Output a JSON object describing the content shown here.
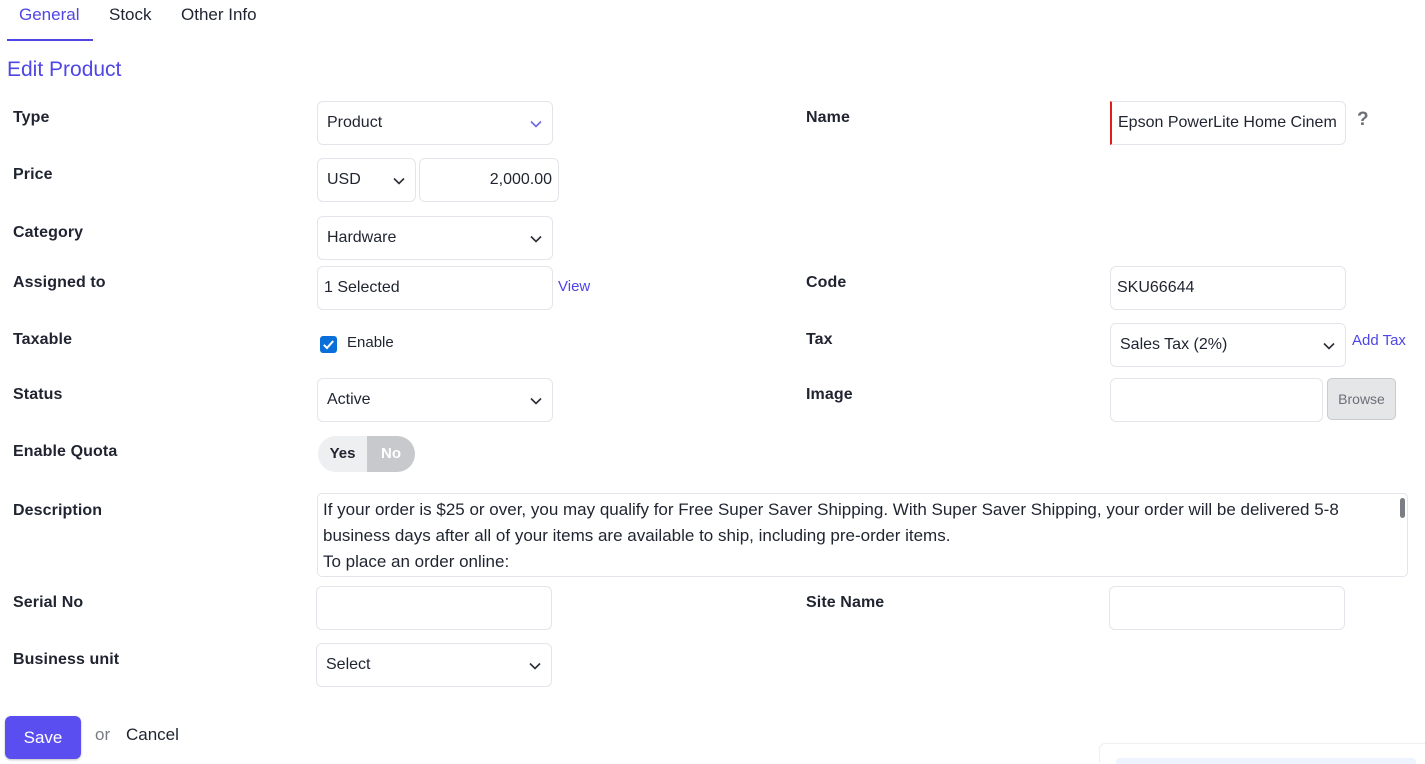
{
  "tabs": [
    {
      "label": "General",
      "active": true
    },
    {
      "label": "Stock",
      "active": false
    },
    {
      "label": "Other Info",
      "active": false
    }
  ],
  "page_title": "Edit Product",
  "accent_color": "#4f46e5",
  "form": {
    "type": {
      "label": "Type",
      "value": "Product"
    },
    "name": {
      "label": "Name",
      "value": "Epson PowerLite Home Cinem",
      "help": "?"
    },
    "price": {
      "label": "Price",
      "currency": "USD",
      "amount": "2,000.00"
    },
    "category": {
      "label": "Category",
      "value": "Hardware"
    },
    "assigned_to": {
      "label": "Assigned to",
      "value": "1 Selected",
      "link": "View"
    },
    "code": {
      "label": "Code",
      "value": "SKU66644"
    },
    "taxable": {
      "label": "Taxable",
      "checkbox_label": "Enable",
      "checked": true
    },
    "tax": {
      "label": "Tax",
      "value": "Sales Tax (2%)",
      "link": "Add Tax"
    },
    "status": {
      "label": "Status",
      "value": "Active"
    },
    "image": {
      "label": "Image",
      "value": "",
      "button": "Browse"
    },
    "enable_quota": {
      "label": "Enable Quota",
      "yes": "Yes",
      "no": "No",
      "selected": "No"
    },
    "description": {
      "label": "Description",
      "lines": [
        "If your order is $25 or over, you may qualify for Free Super Saver Shipping. With Super Saver Shipping, your order will be delivered 5-8 business days after all of your items are available to ship, including pre-order items.",
        "To place an order online:"
      ]
    },
    "serial_no": {
      "label": "Serial No",
      "value": ""
    },
    "site_name": {
      "label": "Site Name",
      "value": ""
    },
    "business_unit": {
      "label": "Business unit",
      "value": "Select"
    }
  },
  "actions": {
    "save": "Save",
    "or": "or",
    "cancel": "Cancel"
  },
  "icons": {
    "dropdown": "chevron-down-icon",
    "checkbox": "checkmark-icon"
  }
}
